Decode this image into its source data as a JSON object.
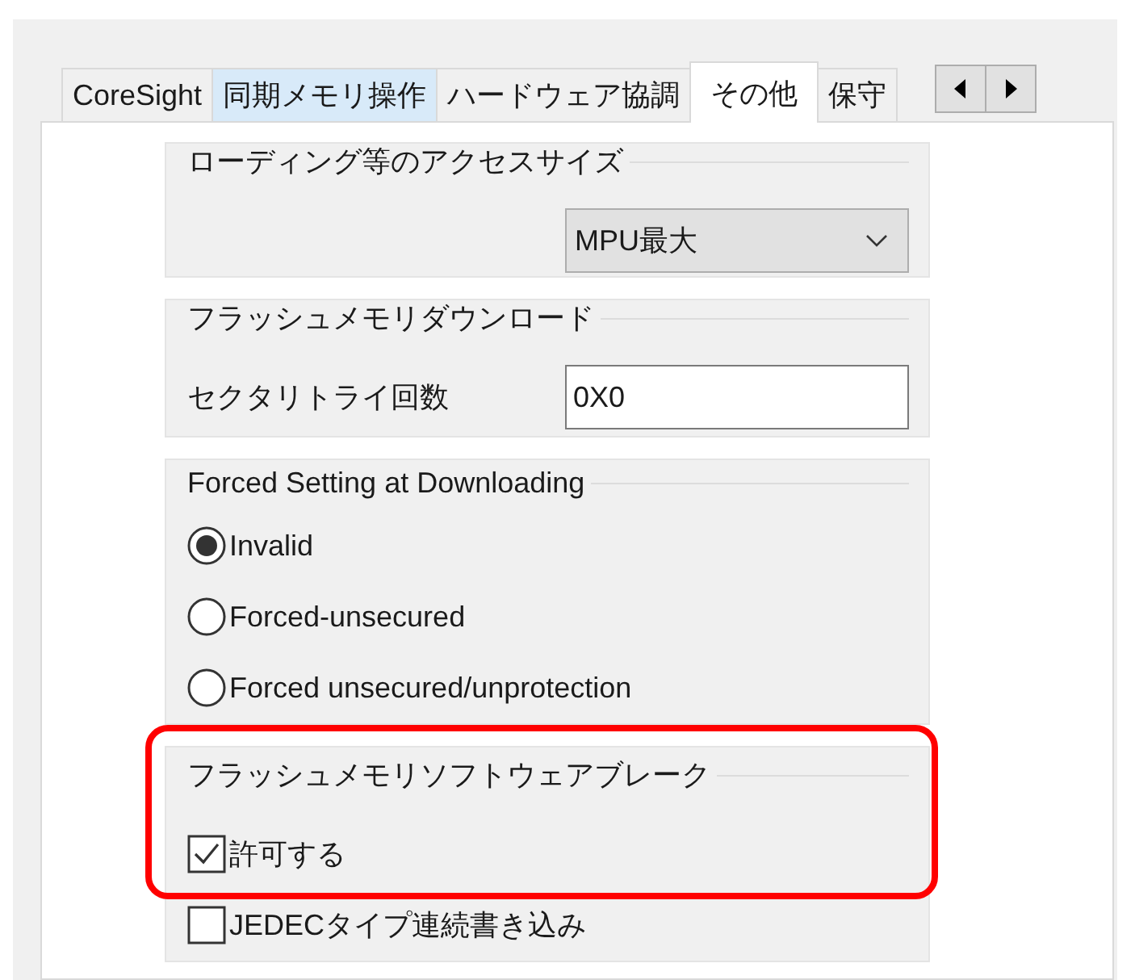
{
  "tabs": [
    {
      "label": "CoreSight",
      "selected": false,
      "hovered": false
    },
    {
      "label": "同期メモリ操作",
      "selected": false,
      "hovered": true
    },
    {
      "label": "ハードウェア協調",
      "selected": false,
      "hovered": false
    },
    {
      "label": "その他",
      "selected": true,
      "hovered": false
    },
    {
      "label": "保守",
      "selected": false,
      "hovered": false
    }
  ],
  "groups": [
    {
      "kind": "dropdown",
      "title": "ローディング等のアクセスサイズ",
      "value": "MPU最大"
    },
    {
      "kind": "field",
      "title": "フラッシュメモリダウンロード",
      "label": "セクタリトライ回数",
      "value": "0X0"
    },
    {
      "kind": "radios",
      "title": "Forced Setting at Downloading",
      "options": [
        {
          "label": "Invalid",
          "selected": true
        },
        {
          "label": "Forced-unsecured",
          "selected": false
        },
        {
          "label": "Forced unsecured/unprotection",
          "selected": false
        }
      ]
    },
    {
      "kind": "checks",
      "title": "フラッシュメモリソフトウェアブレーク",
      "highlighted": true,
      "options": [
        {
          "label": "許可する",
          "checked": true,
          "highlighted": true
        },
        {
          "label": "JEDECタイプ連続書き込み",
          "checked": false,
          "highlighted": false
        }
      ]
    }
  ]
}
